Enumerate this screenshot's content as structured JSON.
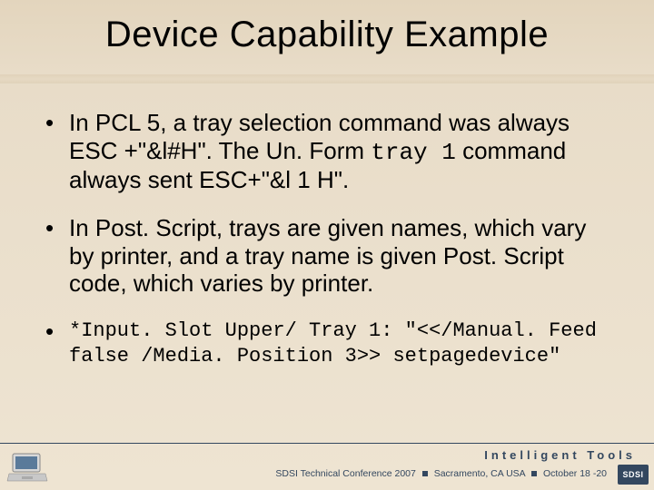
{
  "title": "Device Capability Example",
  "bullets": {
    "b1_pre": "In PCL 5, a tray selection command was always ESC +\"&l#H\".  The Un. Form ",
    "b1_code": "tray 1",
    "b1_post": " command always sent ESC+\"&l 1 H\".",
    "b2": "In Post. Script, trays are given names, which vary by printer, and a tray name is given Post. Script code, which varies by printer.",
    "b3": "*Input. Slot Upper/ Tray 1: \"<</Manual. Feed false /Media. Position 3>> setpagedevice\""
  },
  "footer": {
    "tagline": "Intelligent Tools",
    "conf": "SDSI Technical Conference 2007",
    "loc": "Sacramento, CA  USA",
    "dates": "October 18 -20",
    "badge": "SDSI"
  }
}
